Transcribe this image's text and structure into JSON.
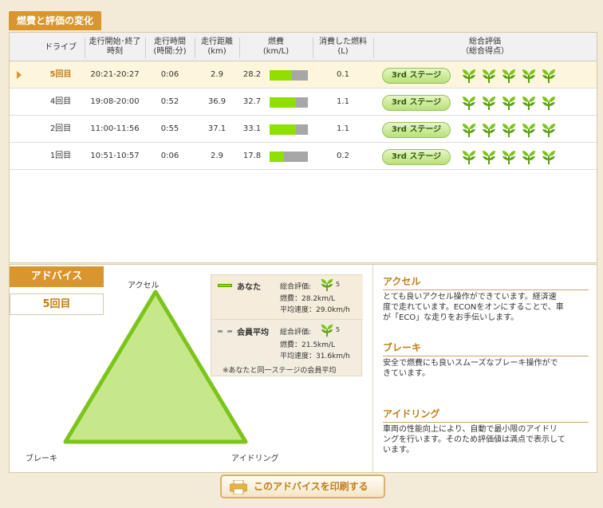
{
  "section_title": "燃費と評価の変化",
  "columns": {
    "drive": "ドライブ",
    "start_end_1": "走行開始･終了",
    "start_end_2": "時刻",
    "duration_1": "走行時間",
    "duration_2": "(時間:分)",
    "distance_1": "走行距離",
    "distance_2": "(km)",
    "fuel_eff_1": "燃費",
    "fuel_eff_2": "(km/L)",
    "fuel_used_1": "消費した燃料",
    "fuel_used_2": "(L)",
    "rating_1": "総合評価",
    "rating_2": "（総合得点）"
  },
  "rows": [
    {
      "drive": "5回目",
      "time": "20:21-20:27",
      "duration": "0:06",
      "distance": "2.9",
      "fuel_eff": "28.2",
      "fuel_eff_level": 0.59,
      "fuel_used": "0.1",
      "stage": "3rd ステージ",
      "leaves": 5,
      "selected": true
    },
    {
      "drive": "4回目",
      "time": "19:08-20:00",
      "duration": "0:52",
      "distance": "36.9",
      "fuel_eff": "32.7",
      "fuel_eff_level": 0.68,
      "fuel_used": "1.1",
      "stage": "3rd ステージ",
      "leaves": 5,
      "selected": false
    },
    {
      "drive": "2回目",
      "time": "11:00-11:56",
      "duration": "0:55",
      "distance": "37.1",
      "fuel_eff": "33.1",
      "fuel_eff_level": 0.69,
      "fuel_used": "1.1",
      "stage": "3rd ステージ",
      "leaves": 5,
      "selected": false
    },
    {
      "drive": "1回目",
      "time": "10:51-10:57",
      "duration": "0:06",
      "distance": "2.9",
      "fuel_eff": "17.8",
      "fuel_eff_level": 0.37,
      "fuel_used": "0.2",
      "stage": "3rd ステージ",
      "leaves": 5,
      "selected": false
    }
  ],
  "advice": {
    "tab_label": "アドバイス",
    "drive_label": "5回目",
    "radar": {
      "axis_top": "アクセル",
      "axis_left": "ブレーキ",
      "axis_right": "アイドリング",
      "levels": {
        "accel": 1.0,
        "brake": 1.0,
        "idling": 1.0
      }
    },
    "legend": {
      "you_name": "あなた",
      "you_rating_label": "総合評価:",
      "you_rating_value": "5",
      "you_fuel": "燃費：28.2km/L",
      "you_speed": "平均速度：29.0km/h",
      "avg_name": "会員平均",
      "avg_rating_label": "総合評価:",
      "avg_rating_value": "5",
      "avg_fuel": "燃費：21.5km/L",
      "avg_speed": "平均速度：31.6km/h",
      "note": "※あなたと同一ステージの会員平均"
    },
    "sections": [
      {
        "title": "アクセル",
        "lines": [
          "とても良いアクセル操作ができています。経済速",
          "度で走れています。ECONをオンにすることで、車",
          "が「ECO」な走りをお手伝いします。"
        ]
      },
      {
        "title": "ブレーキ",
        "lines": [
          "安全で燃費にも良いスムーズなブレーキ操作がで",
          "きています。"
        ]
      },
      {
        "title": "アイドリング",
        "lines": [
          "車両の性能向上により、自動で最小限のアイドリ",
          "ングを行います。そのため評価値は満点で表示して",
          "います。"
        ]
      }
    ]
  },
  "print_label": "このアドバイスを印刷する",
  "colors": {
    "accent": "#d9962e",
    "green": "#8ee000",
    "radar_fill": "#c7e88a",
    "radar_stroke": "#7cc41a"
  }
}
